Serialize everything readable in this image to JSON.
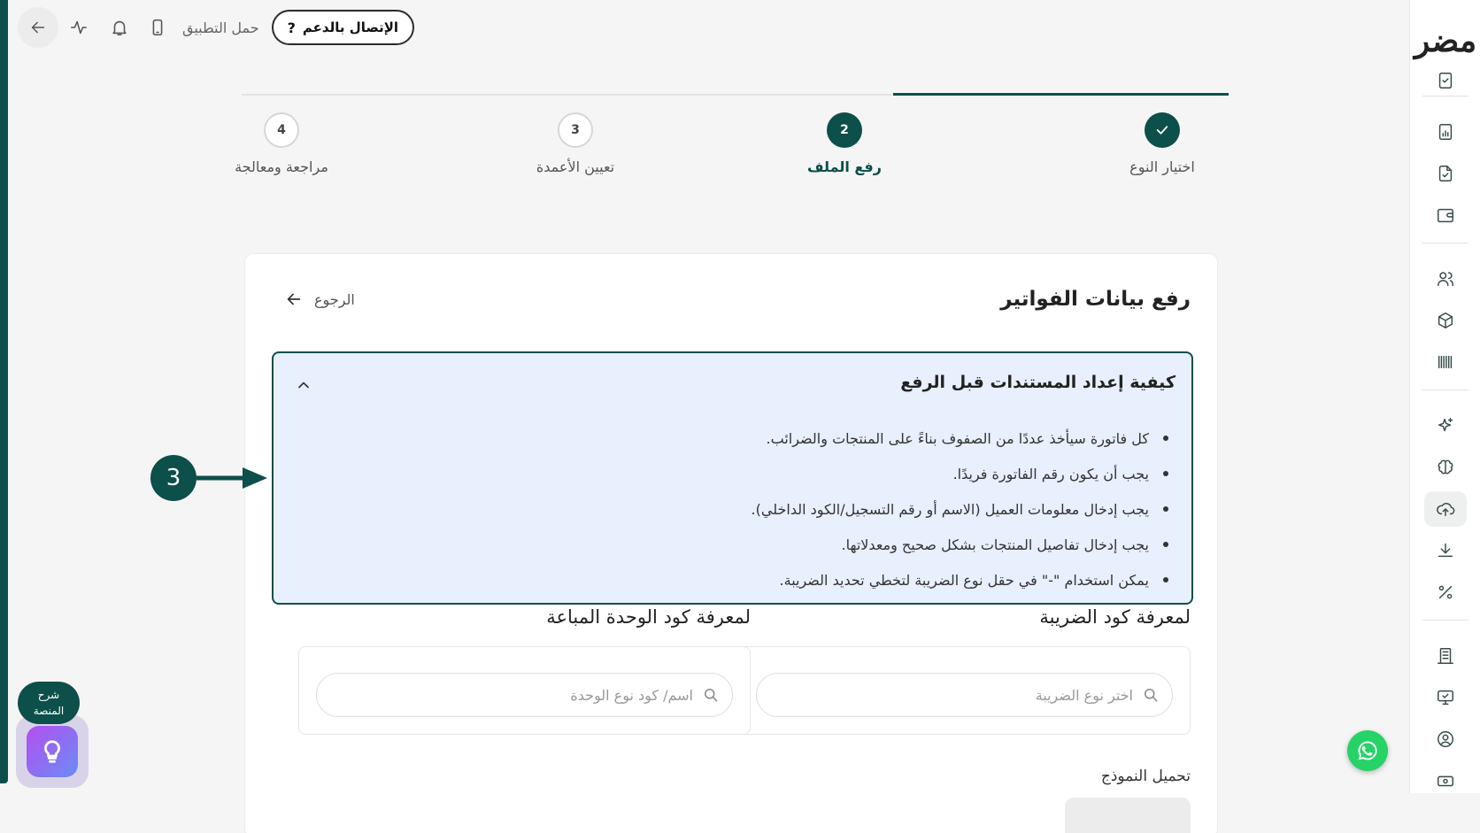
{
  "topbar": {
    "support_label": "الإتصال بالدعم",
    "support_icon": "?",
    "app_download_label": "حمل التطبيق"
  },
  "sidebar": {
    "logo_text": "مضر",
    "items": [
      "tasks-icon",
      "report-icon",
      "document-check-icon",
      "wallet-icon",
      "users-icon",
      "box-icon",
      "barcode-icon",
      "sparkle-icon",
      "brain-icon",
      "cloud-upload-icon",
      "download-icon",
      "percent-icon",
      "building-icon",
      "monitor-check-icon",
      "user-circle-icon",
      "cash-icon"
    ],
    "active_item": "cloud-upload-icon"
  },
  "stepper": {
    "progress_fraction": 0.34,
    "steps": [
      {
        "number": "1",
        "label": "اختيار النوع",
        "state": "done"
      },
      {
        "number": "2",
        "label": "رفع الملف",
        "state": "current"
      },
      {
        "number": "3",
        "label": "تعيين الأعمدة",
        "state": "todo"
      },
      {
        "number": "4",
        "label": "مراجعة ومعالجة",
        "state": "todo"
      }
    ]
  },
  "card": {
    "title": "رفع بيانات الفواتير",
    "back_label": "الرجوع"
  },
  "info_box": {
    "title": "كيفية إعداد المستندات قبل الرفع",
    "items": [
      "كل فاتورة سيأخذ عددًا من الصفوف بناءً على المنتجات والضرائب.",
      "يجب أن يكون رقم الفاتورة فريدًا.",
      "يجب إدخال معلومات العميل (الاسم أو رقم التسجيل/الكود الداخلي).",
      "يجب إدخال تفاصيل المنتجات بشكل صحيح ومعدلاتها.",
      "يمكن استخدام \"-\" في حقل نوع الضريبة لتخطي تحديد الضريبة."
    ]
  },
  "tax_lookup": {
    "heading": "لمعرفة كود الضريبة",
    "placeholder": "اختر نوع الضريبة"
  },
  "unit_lookup": {
    "heading": "لمعرفة كود الوحدة المباعة",
    "placeholder": "اسم/ كود نوع الوحدة"
  },
  "download": {
    "label": "تحميل النموذج"
  },
  "annotation": {
    "number": "3"
  },
  "help": {
    "label_line1": "شرح",
    "label_line2": "المنصة"
  },
  "colors": {
    "primary": "#0d4f4a",
    "info_bg": "#e8effd",
    "whatsapp": "#25d366"
  }
}
